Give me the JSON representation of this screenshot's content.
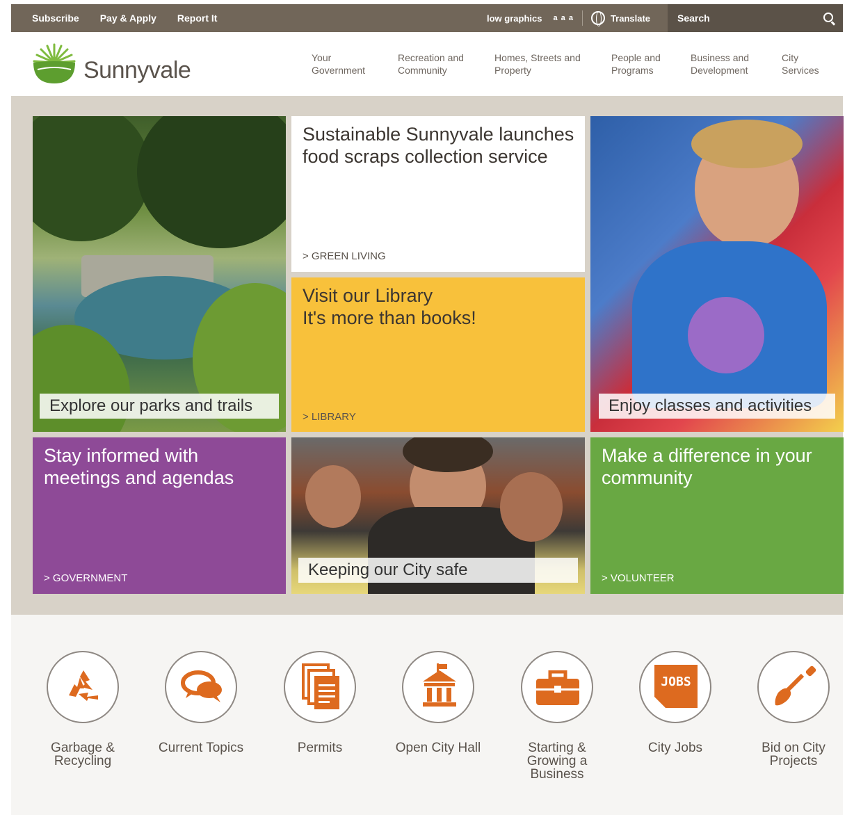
{
  "utility": {
    "links": [
      "Subscribe",
      "Pay & Apply",
      "Report It"
    ],
    "low_graphics": "low graphics",
    "text_size": "a a a",
    "translate": "Translate",
    "search_placeholder": "Search"
  },
  "brand": {
    "name": "Sunnyvale"
  },
  "nav": [
    {
      "line1": "Your",
      "line2": "Government"
    },
    {
      "line1": "Recreation and",
      "line2": "Community"
    },
    {
      "line1": "Homes, Streets and",
      "line2": "Property"
    },
    {
      "line1": "People and",
      "line2": "Programs"
    },
    {
      "line1": "Business and",
      "line2": "Development"
    },
    {
      "line1": "City",
      "line2": "Services"
    }
  ],
  "tiles": {
    "parks": {
      "caption": "Explore our parks and trails"
    },
    "sustain": {
      "title": "Sustainable Sunnyvale launches food scraps collection service",
      "link": "> GREEN LIVING"
    },
    "library": {
      "line1": "Visit our Library",
      "line2": "It's more than books!",
      "link": "> LIBRARY"
    },
    "classes": {
      "caption": "Enjoy classes and activities"
    },
    "stay": {
      "title": "Stay informed with meetings and agendas",
      "link": "> GOVERNMENT"
    },
    "safe": {
      "caption": "Keeping our City safe"
    },
    "diff": {
      "title": "Make a difference in your community",
      "link": "> VOLUNTEER"
    }
  },
  "quick_links": [
    {
      "label": "Garbage & Recycling",
      "icon": "recycle-icon"
    },
    {
      "label": "Current Topics",
      "icon": "chat-bubbles-icon"
    },
    {
      "label": "Permits",
      "icon": "documents-icon"
    },
    {
      "label": "Open City Hall",
      "icon": "city-hall-icon"
    },
    {
      "label": "Starting & Growing a Business",
      "icon": "briefcase-icon"
    },
    {
      "label": "City Jobs",
      "icon": "jobs-icon",
      "badge": "JOBS"
    },
    {
      "label": "Bid on City Projects",
      "icon": "shovel-icon"
    }
  ],
  "colors": {
    "utility_bar": "#716659",
    "library_yellow": "#f8c13b",
    "government_purple": "#8e4a97",
    "volunteer_green": "#69a843",
    "icon_orange": "#dd6a1f"
  }
}
